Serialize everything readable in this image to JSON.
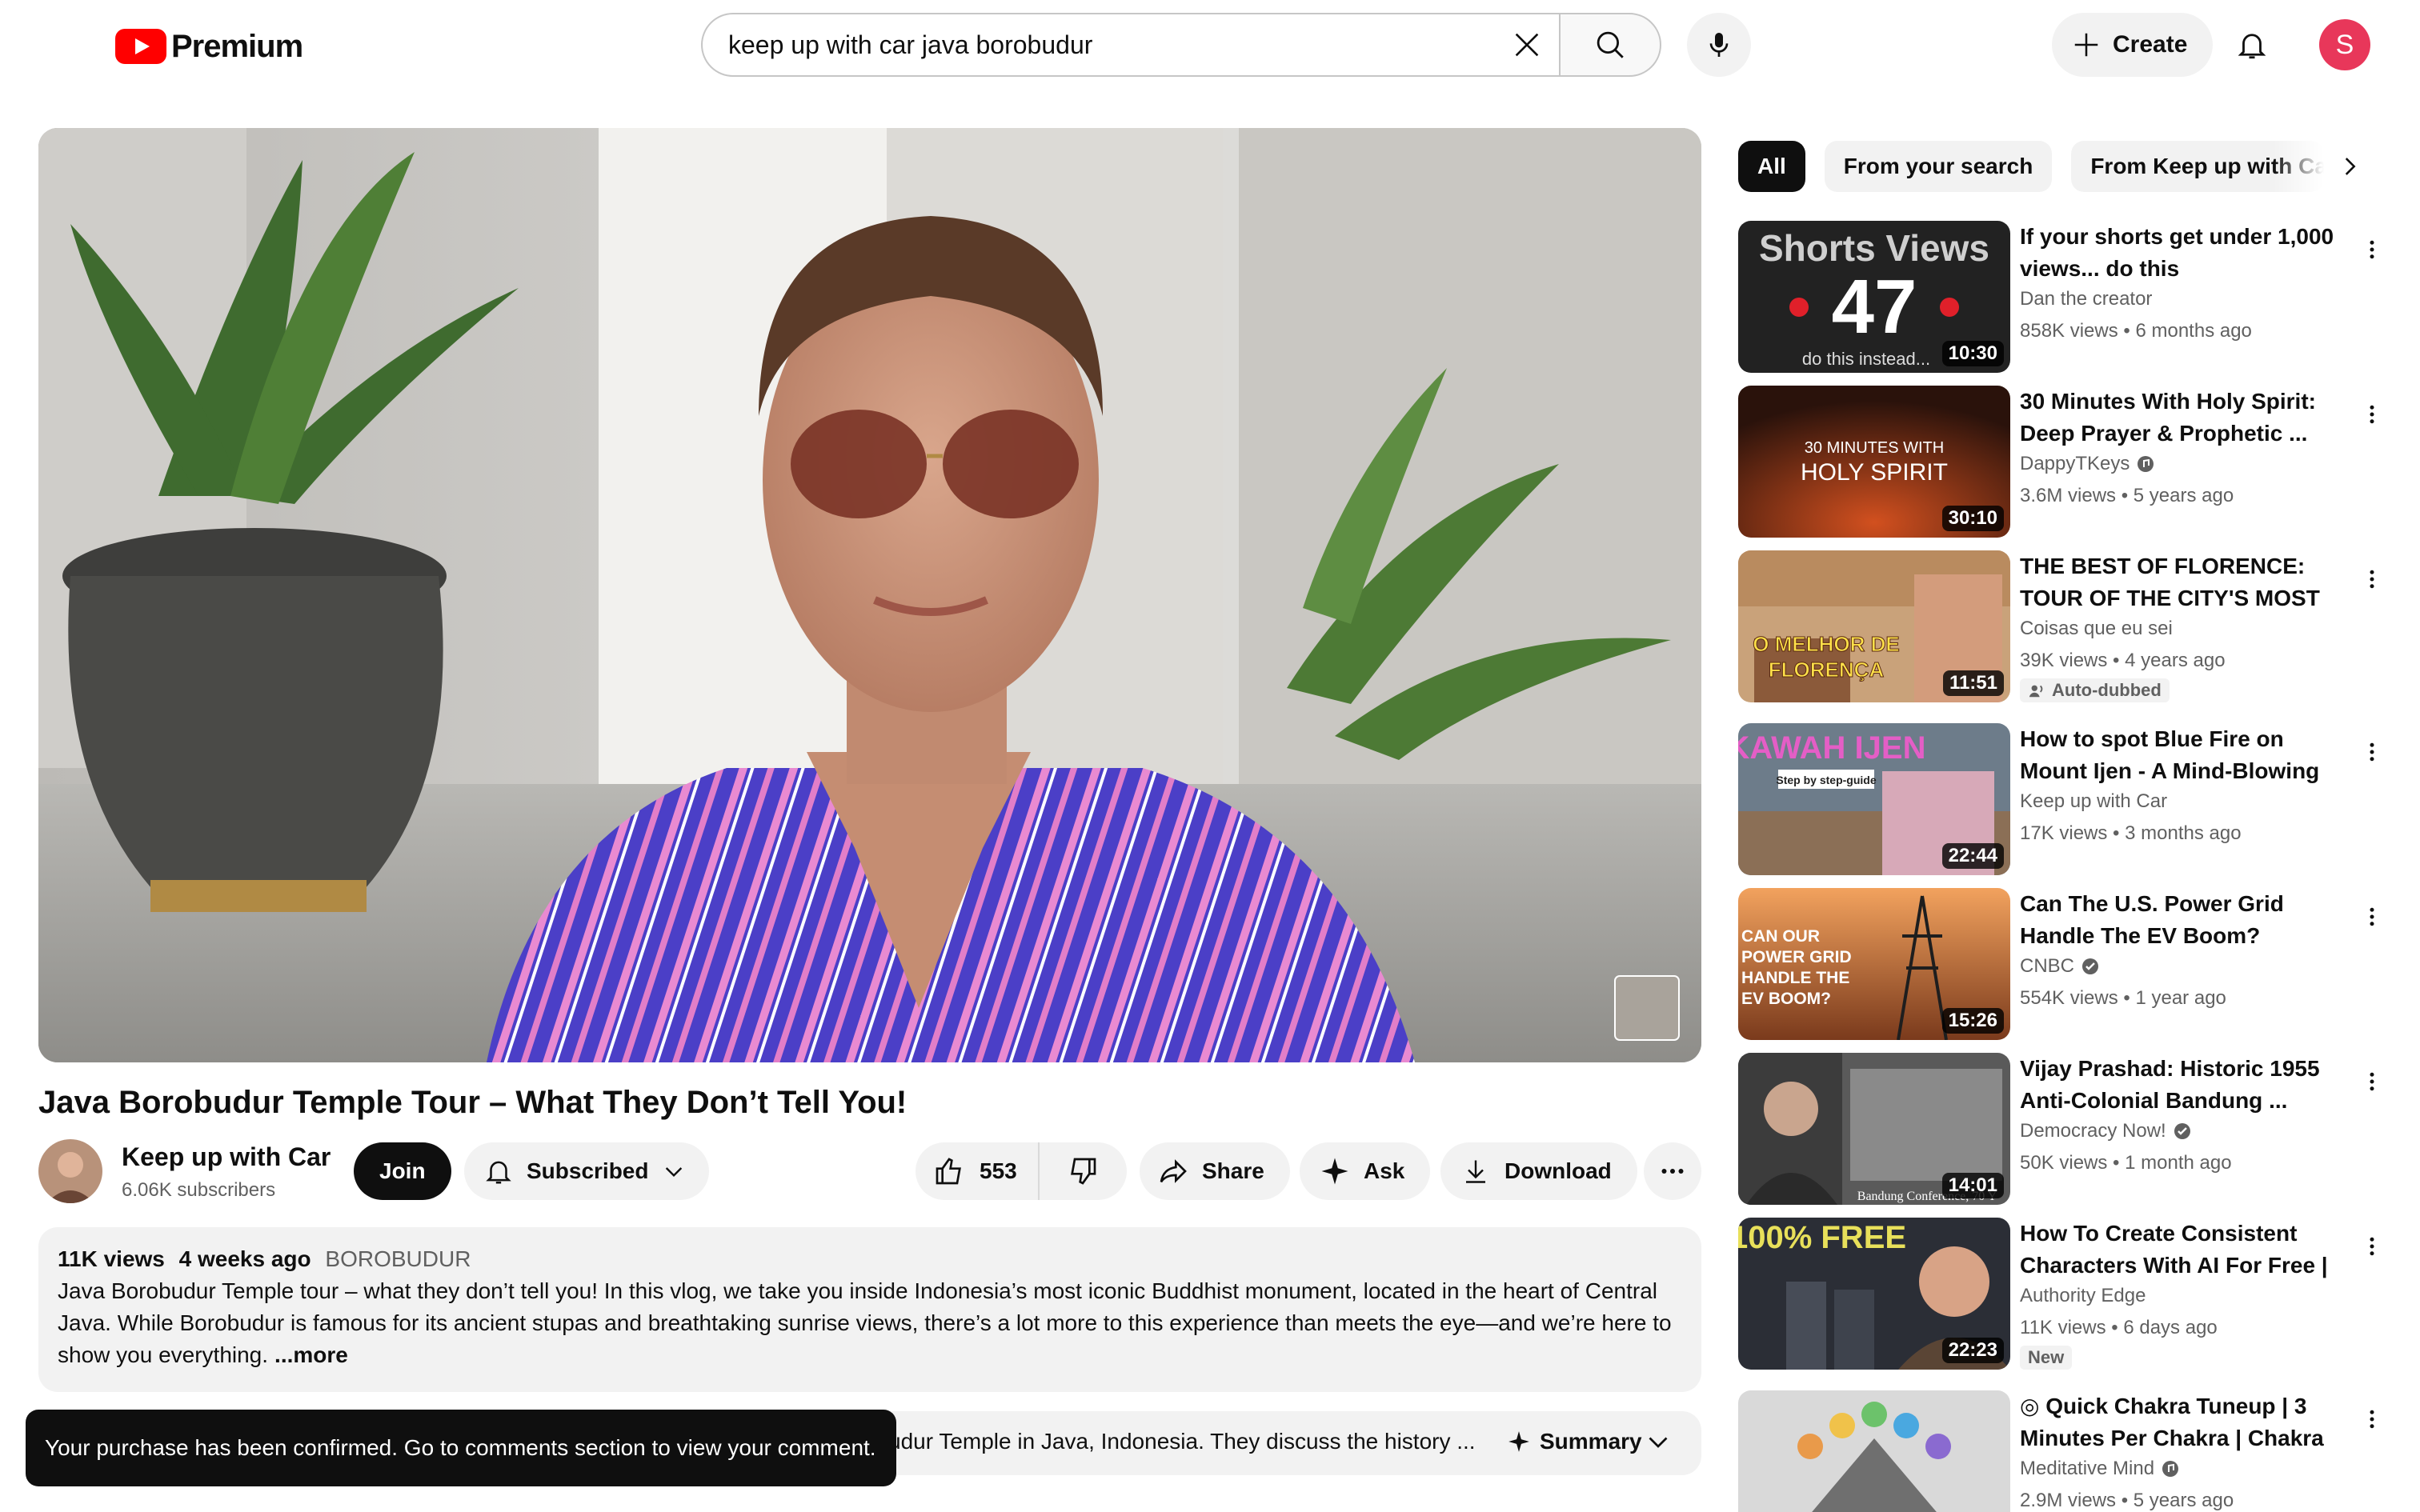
{
  "header": {
    "logo_text": "Premium",
    "search_value": "keep up with car java borobudur",
    "create_label": "Create",
    "avatar_letter": "S"
  },
  "video": {
    "title": "Java Borobudur Temple Tour – What They Don’t Tell You!",
    "channel": "Keep up with Car",
    "subscribers": "6.06K subscribers",
    "join_label": "Join",
    "subscribed_label": "Subscribed",
    "likes": "553",
    "share_label": "Share",
    "ask_label": "Ask",
    "download_label": "Download"
  },
  "description": {
    "views": "11K views",
    "age": "4 weeks ago",
    "location": "BOROBUDUR",
    "text": "Java Borobudur Temple tour – what they don’t tell you! In this vlog, we take you inside Indonesia’s most iconic Buddhist monument, located in the heart of Central Java. While Borobudur is famous for its ancient stupas and breathtaking sunrise views, there’s a lot more to this experience than meets the eye—and we’re here to show you everything.",
    "more_label": "...more"
  },
  "summary": {
    "text": "udur Temple in Java, Indonesia. They discuss the history ...",
    "button_label": "Summary"
  },
  "toast": {
    "message": "Your purchase has been confirmed. Go to comments section to view your comment."
  },
  "chips": [
    {
      "label": "All"
    },
    {
      "label": "From your search"
    },
    {
      "label": "From Keep up with Car"
    }
  ],
  "recommendations": [
    {
      "title": "If your shorts get under 1,000 views... do this",
      "channel": "Dan the creator",
      "meta": "858K views • 6 months ago",
      "duration": "10:30",
      "thumb_text": "Shorts Views",
      "thumb_num": "47",
      "thumb_sub": "do this instead..."
    },
    {
      "title": "30 Minutes With Holy Spirit: Deep Prayer & Prophetic ...",
      "channel": "DappyTKeys",
      "meta": "3.6M views • 5 years ago",
      "duration": "30:10",
      "thumb_text": "30 MINUTES WITH",
      "thumb_sub": "HOLY SPIRIT"
    },
    {
      "title": "THE BEST OF FLORENCE: TOUR OF THE CITY'S MOST ...",
      "channel": "Coisas que eu sei",
      "meta": "39K views • 4 years ago",
      "badge": "Auto-dubbed",
      "duration": "11:51",
      "thumb_text": "O MELHOR DE",
      "thumb_sub": "FLORENÇA"
    },
    {
      "title": "How to spot Blue Fire on Mount Ijen - A Mind-Blowing Night ...",
      "channel": "Keep up with Car",
      "meta": "17K views • 3 months ago",
      "duration": "22:44",
      "thumb_text": "KAWAH IJEN",
      "thumb_sub": "Step by step-guide"
    },
    {
      "title": "Can The U.S. Power Grid Handle The EV Boom?",
      "channel": "CNBC",
      "meta": "554K views • 1 year ago",
      "duration": "15:26",
      "thumb_text": "CAN OUR POWER GRID HANDLE THE EV BOOM?"
    },
    {
      "title": "Vijay Prashad: Historic 1955 Anti-Colonial Bandung ...",
      "channel": "Democracy Now!",
      "meta": "50K views • 1 month ago",
      "duration": "14:01",
      "thumb_text": "Bandung Conference, 70 Y"
    },
    {
      "title": "How To Create Consistent Characters With AI For Free | ...",
      "channel": "Authority Edge",
      "meta": "11K views • 6 days ago",
      "badge": "New",
      "duration": "22:23",
      "thumb_text": "100% FREE"
    },
    {
      "title": "◎ Quick Chakra Tuneup | 3 Minutes Per Chakra | Chakra ...",
      "channel": "Meditative Mind",
      "meta": "2.9M views • 5 years ago",
      "duration": ""
    }
  ],
  "colors": {
    "accent_red": "#ff0000",
    "avatar_bg": "#e8375a",
    "chip_bg": "#f2f2f2",
    "text_primary": "#0f0f0f",
    "text_secondary": "#606060"
  }
}
